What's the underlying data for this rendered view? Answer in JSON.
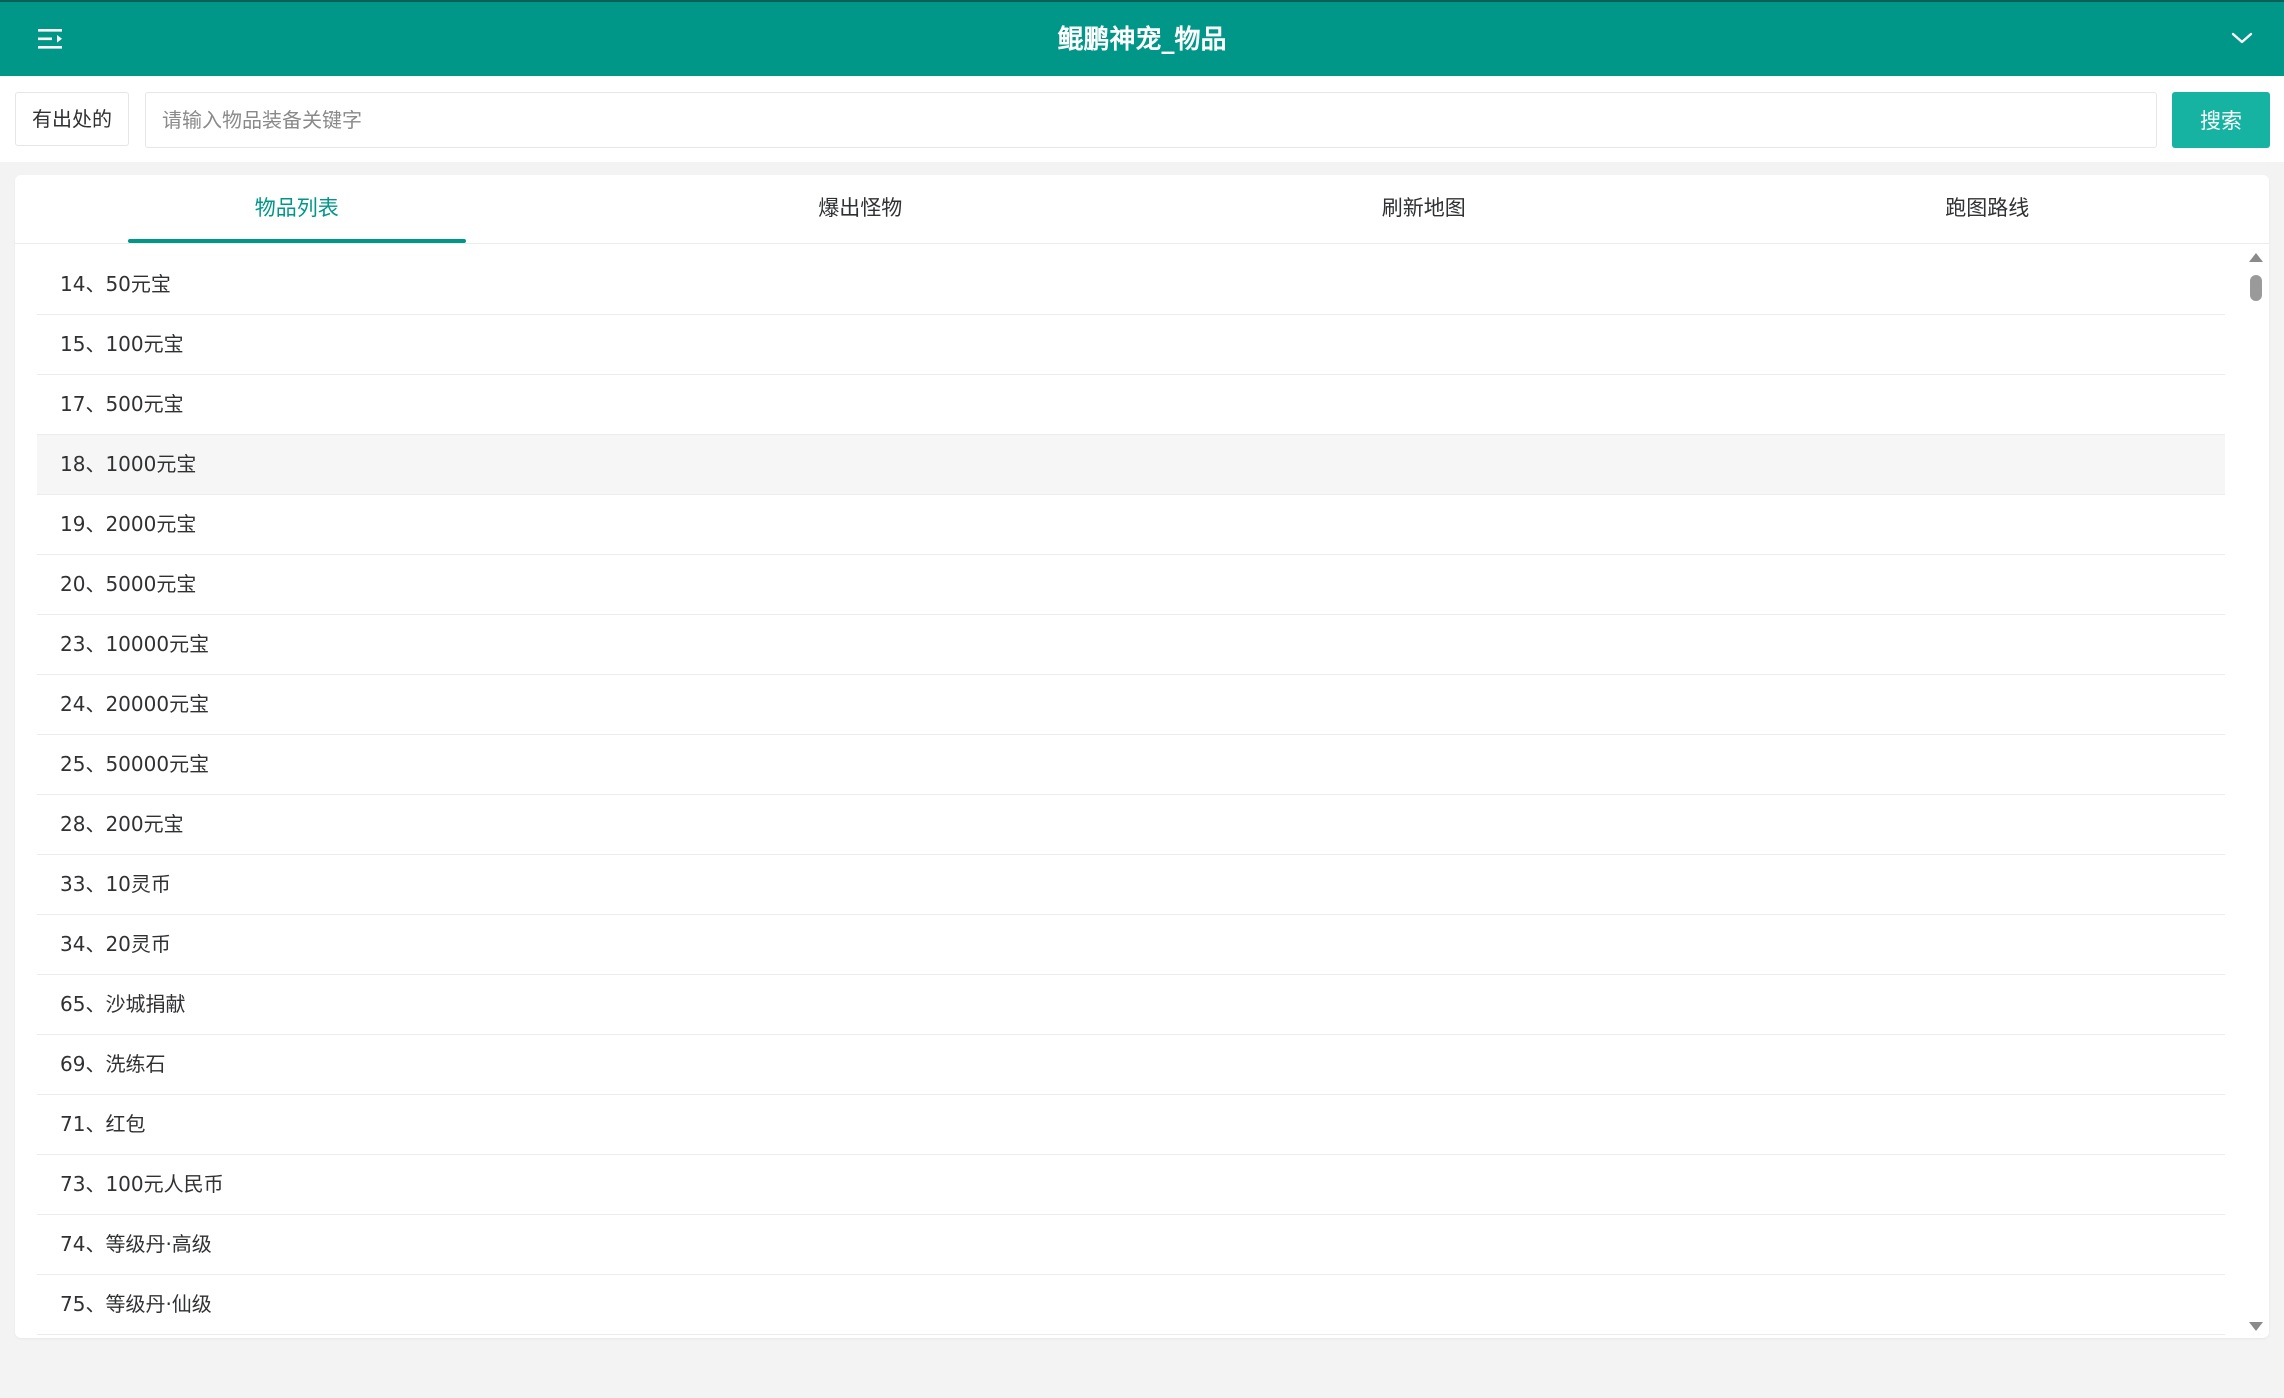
{
  "header": {
    "title": "鲲鹏神宠_物品",
    "background_color": "#009688",
    "menu_icon": "menu-fold-icon",
    "dropdown_icon": "chevron-down-icon"
  },
  "search": {
    "filter_label": "有出处的",
    "placeholder": "请输入物品装备关键字",
    "value": "",
    "button_label": "搜索",
    "button_color": "#16b3a3"
  },
  "tabs": [
    {
      "label": "物品列表",
      "active": true
    },
    {
      "label": "爆出怪物",
      "active": false
    },
    {
      "label": "刷新地图",
      "active": false
    },
    {
      "label": "跑图路线",
      "active": false
    }
  ],
  "items": [
    {
      "label": "14、50元宝"
    },
    {
      "label": "15、100元宝"
    },
    {
      "label": "17、500元宝"
    },
    {
      "label": "18、1000元宝"
    },
    {
      "label": "19、2000元宝"
    },
    {
      "label": "20、5000元宝"
    },
    {
      "label": "23、10000元宝"
    },
    {
      "label": "24、20000元宝"
    },
    {
      "label": "25、50000元宝"
    },
    {
      "label": "28、200元宝"
    },
    {
      "label": "33、10灵币"
    },
    {
      "label": "34、20灵币"
    },
    {
      "label": "65、沙城捐献"
    },
    {
      "label": "69、洗练石"
    },
    {
      "label": "71、红包"
    },
    {
      "label": "73、100元人民币"
    },
    {
      "label": "74、等级丹·高级"
    },
    {
      "label": "75、等级丹·仙级"
    }
  ]
}
